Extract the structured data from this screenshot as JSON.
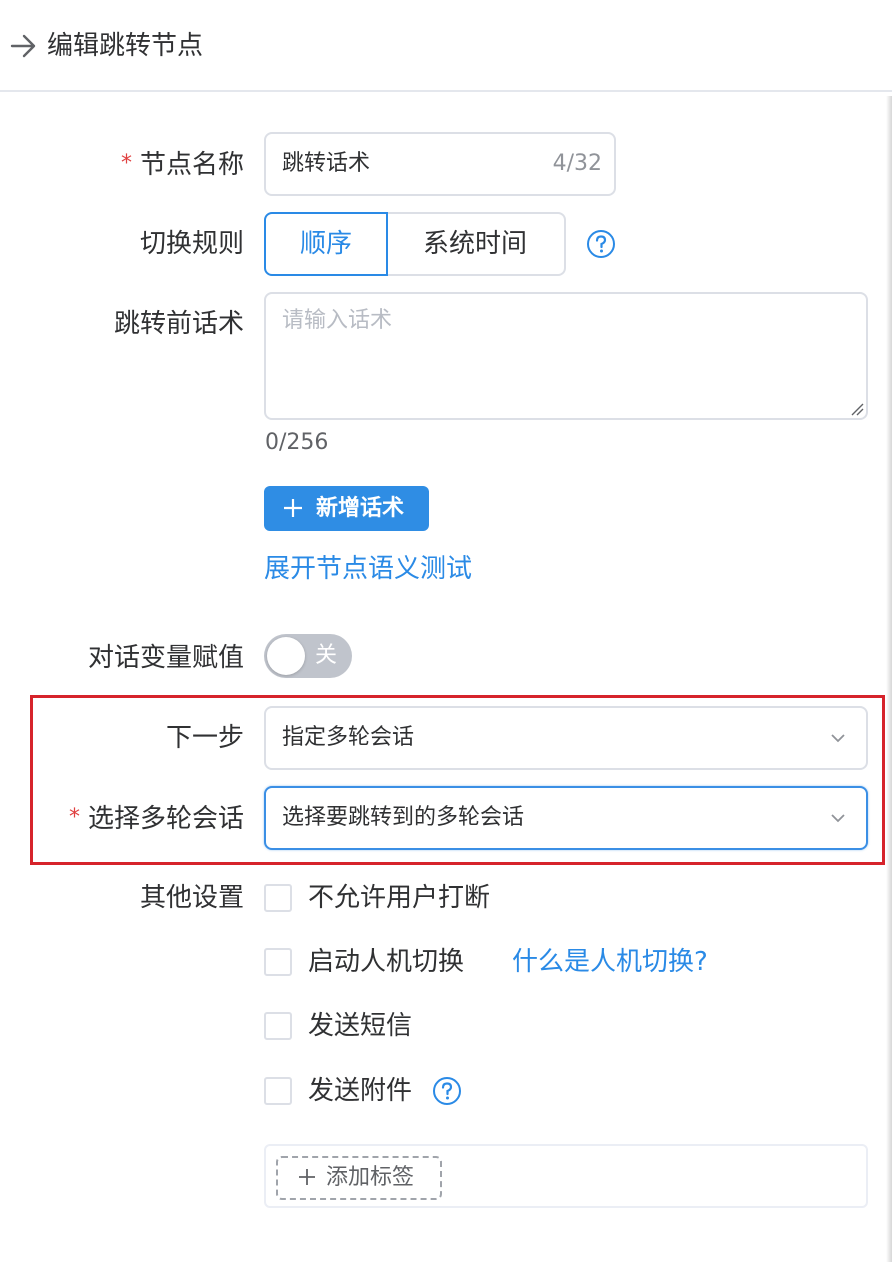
{
  "header": {
    "title": "编辑跳转节点",
    "back_icon": "arrow-right-icon"
  },
  "form": {
    "node_name": {
      "label": "节点名称",
      "required_mark": "*",
      "value": "跳转话术",
      "counter": "4/32"
    },
    "switch_rule": {
      "label": "切换规则",
      "options": [
        "顺序",
        "系统时间"
      ],
      "selected": "顺序"
    },
    "pre_jump_speech": {
      "label": "跳转前话术",
      "placeholder": "请输入话术",
      "counter": "0/256"
    },
    "add_speech_button": "新增话术",
    "expand_test_link": "展开节点语义测试",
    "dialog_var": {
      "label": "对话变量赋值",
      "switch_text": "关",
      "state": "off"
    },
    "next_step": {
      "label": "下一步",
      "value": "指定多轮会话"
    },
    "select_multi": {
      "label": "选择多轮会话",
      "required_mark": "*",
      "placeholder": "选择要跳转到的多轮会话"
    },
    "other_settings": {
      "label": "其他设置",
      "options": [
        {
          "label": "不允许用户打断",
          "checked": false
        },
        {
          "label": "启动人机切换",
          "checked": false,
          "link": "什么是人机切换?"
        },
        {
          "label": "发送短信",
          "checked": false
        },
        {
          "label": "发送附件",
          "checked": false
        }
      ]
    },
    "add_tag_button": "添加标签"
  },
  "colors": {
    "primary": "#2a8ae6",
    "button": "#2f8de4",
    "highlight_border": "#d6232b",
    "required": "#e04040"
  }
}
